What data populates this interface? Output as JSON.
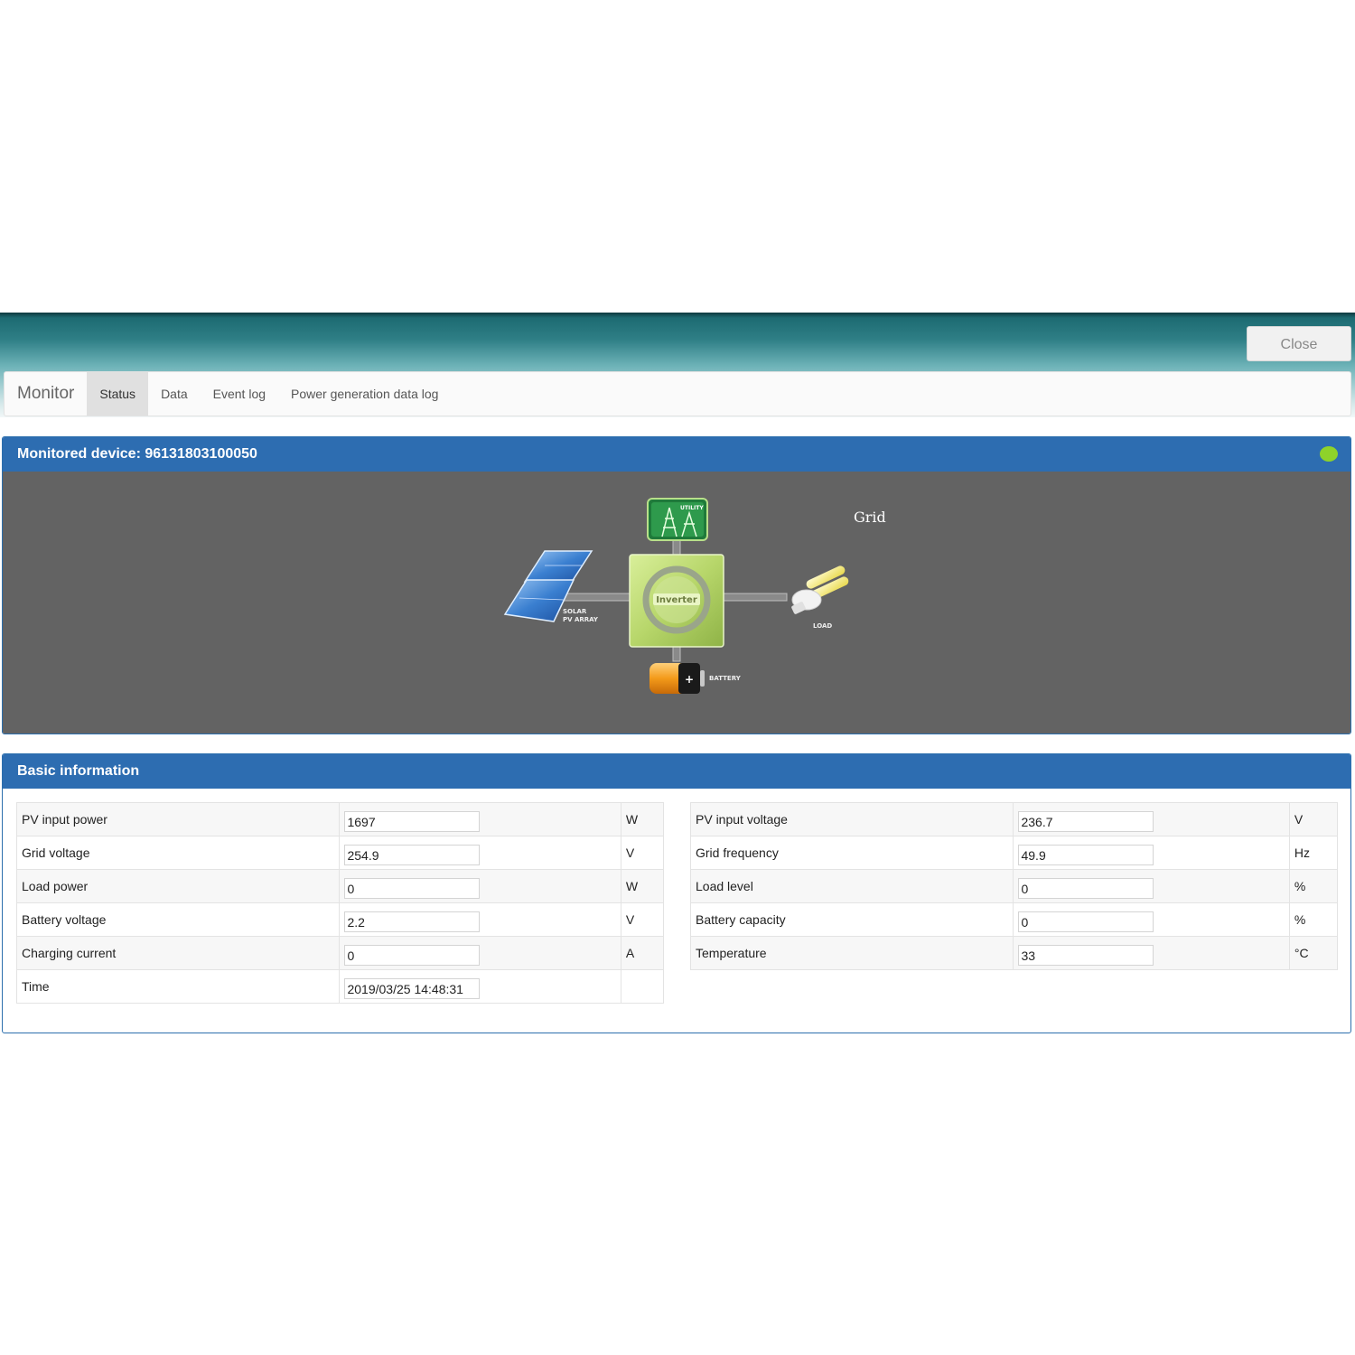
{
  "window": {
    "close_label": "Close"
  },
  "nav": {
    "brand": "Monitor",
    "tabs": [
      "Status",
      "Data",
      "Event log",
      "Power generation data log"
    ],
    "active_tab": "Status"
  },
  "monitor": {
    "title": "Monitored device: 96131803100050",
    "status_color": "#8ed22a",
    "mode_label": "Grid",
    "diagram": {
      "utility_label": "UTILITY",
      "inverter_label": "Inverter",
      "solar_label_1": "SOLAR",
      "solar_label_2": "PV ARRAY",
      "load_label": "LOAD",
      "battery_label": "BATTERY"
    }
  },
  "basic_info": {
    "title": "Basic information",
    "left": [
      {
        "label": "PV input power",
        "value": "1697",
        "unit": "W"
      },
      {
        "label": "Grid voltage",
        "value": "254.9",
        "unit": "V"
      },
      {
        "label": "Load power",
        "value": "0",
        "unit": "W"
      },
      {
        "label": "Battery voltage",
        "value": "2.2",
        "unit": "V"
      },
      {
        "label": "Charging current",
        "value": "0",
        "unit": "A"
      },
      {
        "label": "Time",
        "value": "2019/03/25 14:48:31",
        "unit": ""
      }
    ],
    "right": [
      {
        "label": "PV input voltage",
        "value": "236.7",
        "unit": "V"
      },
      {
        "label": "Grid frequency",
        "value": "49.9",
        "unit": "Hz"
      },
      {
        "label": "Load level",
        "value": "0",
        "unit": "%"
      },
      {
        "label": "Battery capacity",
        "value": "0",
        "unit": "%"
      },
      {
        "label": "Temperature",
        "value": "33",
        "unit": "°C"
      }
    ]
  }
}
